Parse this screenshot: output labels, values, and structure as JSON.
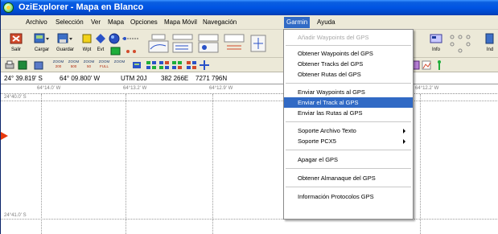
{
  "window": {
    "title": "OziExplorer - Mapa en Blanco"
  },
  "menubar": {
    "items": [
      "Archivo",
      "Selección",
      "Ver",
      "Mapa",
      "Opciones",
      "Mapa Móvil",
      "Navegación",
      "Garmin",
      "Ayuda"
    ],
    "active": "Garmin"
  },
  "toolbar": {
    "labels": {
      "salir": "Salir",
      "cargar": "Cargar",
      "guardar": "Guardar",
      "wpt": "Wpt",
      "evt": "Evt",
      "info": "Info",
      "ind": "Ind"
    }
  },
  "toolbar2": {
    "zoom_buttons": [
      {
        "top": "ZOOM",
        "bottom": "200"
      },
      {
        "top": "ZOOM",
        "bottom": "500"
      },
      {
        "top": "ZOOM",
        "bottom": "50"
      },
      {
        "top": "ZOOM",
        "bottom": "FULL"
      },
      {
        "top": "ZOOM",
        "bottom": ""
      }
    ]
  },
  "coordinates": {
    "lat": "24° 39.819' S",
    "lon": "64° 09.800' W",
    "utm": "UTM 20J",
    "easting": "382 266E",
    "northing": "7271 796N"
  },
  "map": {
    "top_ticks": [
      "64°14.0' W",
      "64°13.2' W",
      "64°12.9' W",
      "64°12.2' W"
    ],
    "left_ticks": [
      "24°40.0' S",
      "24°41.0' S"
    ]
  },
  "garmin_menu": {
    "items": [
      {
        "label": "Añadir Waypoints del GPS",
        "disabled": true
      },
      {
        "label": "Obtener Waypoints del GPS"
      },
      {
        "label": "Obtener Tracks del GPS"
      },
      {
        "label": "Obtener Rutas del GPS"
      },
      {
        "label": "Enviar Waypoints al GPS"
      },
      {
        "label": "Enviar el Track al GPS",
        "selected": true
      },
      {
        "label": "Enviar las Rutas al GPS"
      },
      {
        "label": "Soporte Archivo Texto",
        "submenu": true
      },
      {
        "label": "Soporte PCX5",
        "submenu": true
      },
      {
        "label": "Apagar el GPS"
      },
      {
        "label": "Obtener Almanaque del GPS"
      },
      {
        "label": "Información Protocolos GPS"
      }
    ]
  },
  "colors": {
    "titlebar": "#0054e3",
    "menu_highlight": "#316ac5",
    "pointer_arrow": "#e8380d"
  }
}
